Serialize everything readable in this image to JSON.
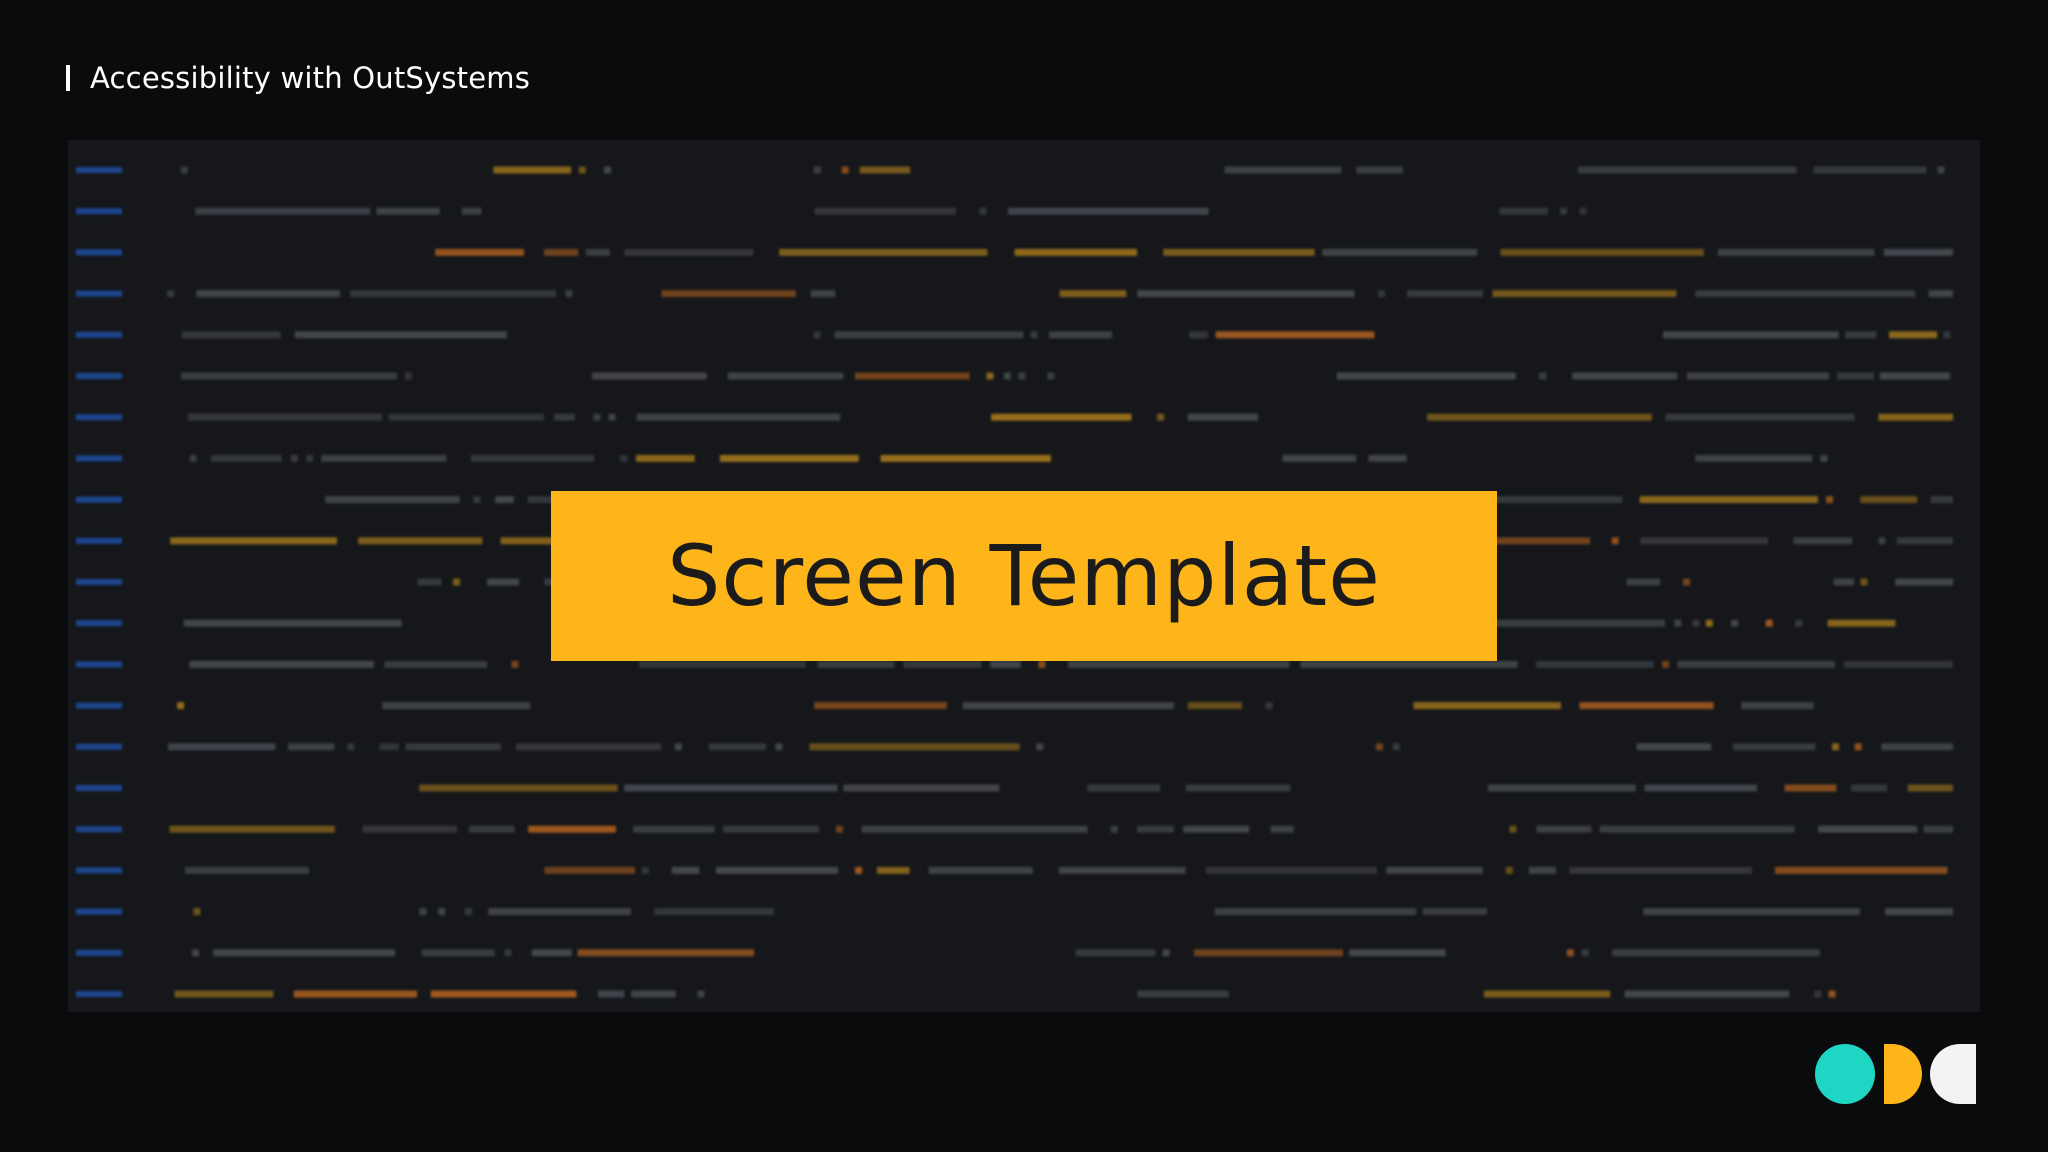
{
  "header": {
    "title": "Accessibility with OutSystems"
  },
  "card": {
    "title": "Screen Template"
  },
  "colors": {
    "background": "#0a0b0d",
    "code_panel": "#15171b",
    "card_fill": "#fdb51a",
    "card_text": "#1b1b1b",
    "logo_teal": "#1fd6c4",
    "logo_yellow": "#fdb51a",
    "logo_white": "#f3f3f5",
    "code_gray": "#4a4d53",
    "code_orange": "#b0611f",
    "code_amber": "#a87b1c",
    "code_blue": "#1e4fa3"
  },
  "icons": {
    "logo": "odc-logo"
  }
}
